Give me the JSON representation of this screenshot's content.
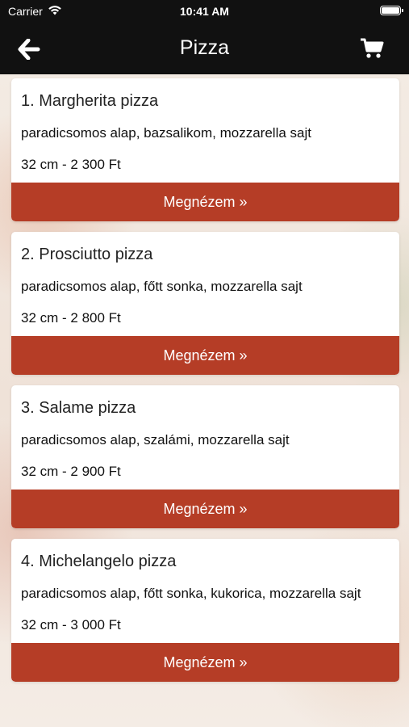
{
  "status_bar": {
    "carrier": "Carrier",
    "time": "10:41 AM"
  },
  "nav": {
    "title": "Pizza"
  },
  "products": [
    {
      "name": "1. Margherita pizza",
      "description": "paradicsomos alap, bazsalikom, mozzarella sajt",
      "price": "32 cm - 2 300 Ft",
      "button": "Megnézem »"
    },
    {
      "name": "2. Prosciutto pizza",
      "description": "paradicsomos alap, főtt sonka, mozzarella sajt",
      "price": "32 cm - 2 800 Ft",
      "button": "Megnézem »"
    },
    {
      "name": "3. Salame pizza",
      "description": "paradicsomos alap, szalámi, mozzarella sajt",
      "price": "32 cm - 2 900 Ft",
      "button": "Megnézem »"
    },
    {
      "name": "4. Michelangelo pizza",
      "description": "paradicsomos alap, főtt sonka, kukorica, mozzarella sajt",
      "price": "32 cm - 3 000 Ft",
      "button": "Megnézem »"
    }
  ],
  "colors": {
    "header_bg": "#111111",
    "button_bg": "#b53d26",
    "card_bg": "#ffffff"
  },
  "icons": {
    "back": "arrow-left-icon",
    "cart": "shopping-cart-icon",
    "wifi": "wifi-icon",
    "battery": "battery-icon"
  }
}
